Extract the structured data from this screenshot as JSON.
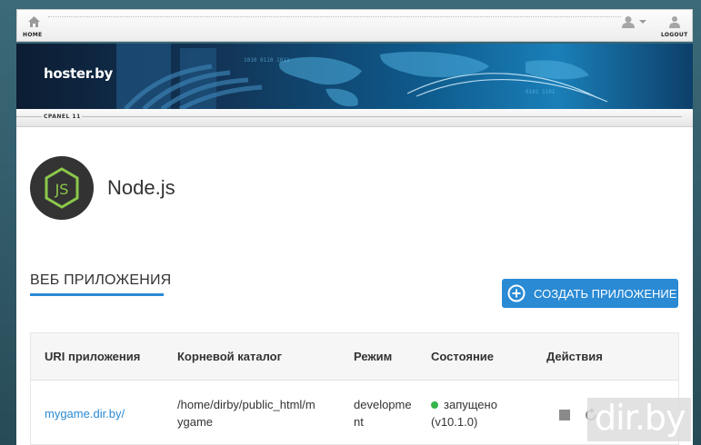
{
  "header": {
    "home_label": "HOME",
    "logout_label": "LOGOUT"
  },
  "banner": {
    "logo_text": "hoster.by"
  },
  "subbar": {
    "cpanel_label": "CPANEL 11"
  },
  "page": {
    "title": "Node.js",
    "section_title": "ВЕБ ПРИЛОЖЕНИЯ",
    "create_button_label": "СОЗДАТЬ ПРИЛОЖЕНИЕ"
  },
  "table": {
    "columns": [
      "URI приложения",
      "Корневой каталог",
      "Режим",
      "Состояние",
      "Действия"
    ],
    "rows": [
      {
        "uri": "mygame.dir.by/",
        "root_line1": "/home/dirby/public_html/m",
        "root_line2": "ygame",
        "mode_line1": "developme",
        "mode_line2": "nt",
        "status_line1": "запущено",
        "status_line2": "(v10.1.0)"
      }
    ]
  },
  "watermark": {
    "text": "dir.by"
  },
  "colors": {
    "accent": "#2a8ad4",
    "status_running": "#35b54a",
    "logo_green": "#8cc84b"
  },
  "icons": [
    "home-icon",
    "user-icon",
    "logout-icon",
    "nodejs-logo-icon",
    "plus-circle-icon",
    "stop-icon",
    "restart-icon"
  ]
}
